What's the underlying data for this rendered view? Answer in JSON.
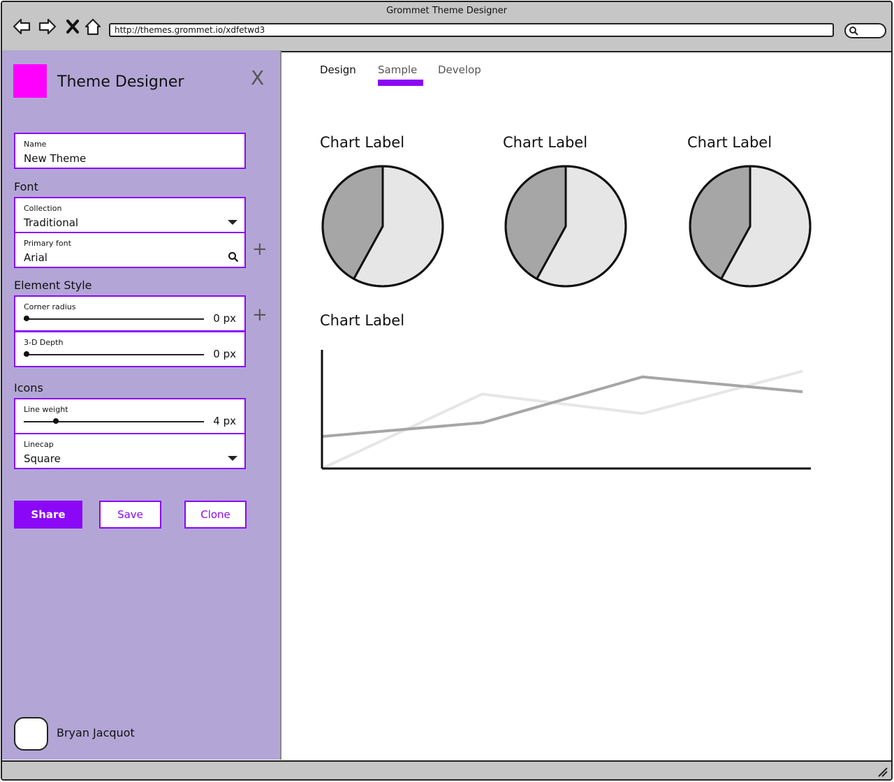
{
  "window": {
    "title": "Grommet Theme Designer",
    "url": "http://themes.grommet.io/xdfetwd3",
    "icons": [
      "back-arrow-icon",
      "forward-arrow-icon",
      "close-x-icon",
      "home-icon",
      "search-icon"
    ]
  },
  "sidebar": {
    "title": "Theme Designer",
    "swatch_color": "#ff00ff",
    "close_label": "X",
    "name_field": {
      "label": "Name",
      "value": "New Theme"
    },
    "font_section": "Font",
    "collection": {
      "label": "Collection",
      "value": "Traditional"
    },
    "primary_font": {
      "label": "Primary font",
      "value": "Arial"
    },
    "add_label": "+",
    "element_style_section": "Element Style",
    "corner_radius": {
      "label": "Corner radius",
      "value": "0 px",
      "level": 0
    },
    "depth": {
      "label": "3-D Depth",
      "value": "0 px",
      "level": 0
    },
    "icons_section": "Icons",
    "line_weight": {
      "label": "Line weight",
      "value": "4 px",
      "level": 0.17
    },
    "linecap": {
      "label": "Linecap",
      "value": "Square"
    },
    "buttons": {
      "share": "Share",
      "save": "Save",
      "clone": "Clone"
    },
    "user": {
      "name": "Bryan Jacquot"
    },
    "accent_color": "#8a08f5",
    "panel_color": "#b3a6d6"
  },
  "tabs": [
    {
      "label": "Design",
      "active": false
    },
    {
      "label": "Sample",
      "active": true
    },
    {
      "label": "Develop",
      "active": false
    }
  ],
  "chart_data": [
    {
      "type": "pie",
      "title": "Chart Label",
      "series": [
        {
          "values": [
            58,
            42
          ],
          "colors": [
            "#e6e6e6",
            "#a6a6a6"
          ]
        }
      ]
    },
    {
      "type": "pie",
      "title": "Chart Label",
      "series": [
        {
          "values": [
            58,
            42
          ],
          "colors": [
            "#e6e6e6",
            "#a6a6a6"
          ]
        }
      ]
    },
    {
      "type": "pie",
      "title": "Chart Label",
      "series": [
        {
          "values": [
            58,
            42
          ],
          "colors": [
            "#e6e6e6",
            "#a6a6a6"
          ]
        }
      ]
    },
    {
      "type": "line",
      "title": "Chart Label",
      "x": [
        0,
        1,
        2,
        3
      ],
      "ylim": [
        0,
        100
      ],
      "series": [
        {
          "values": [
            0,
            65,
            48,
            85
          ],
          "color": "#e6e6e6"
        },
        {
          "values": [
            28,
            40,
            80,
            67
          ],
          "color": "#a6a6a6"
        }
      ],
      "grid": false
    }
  ]
}
